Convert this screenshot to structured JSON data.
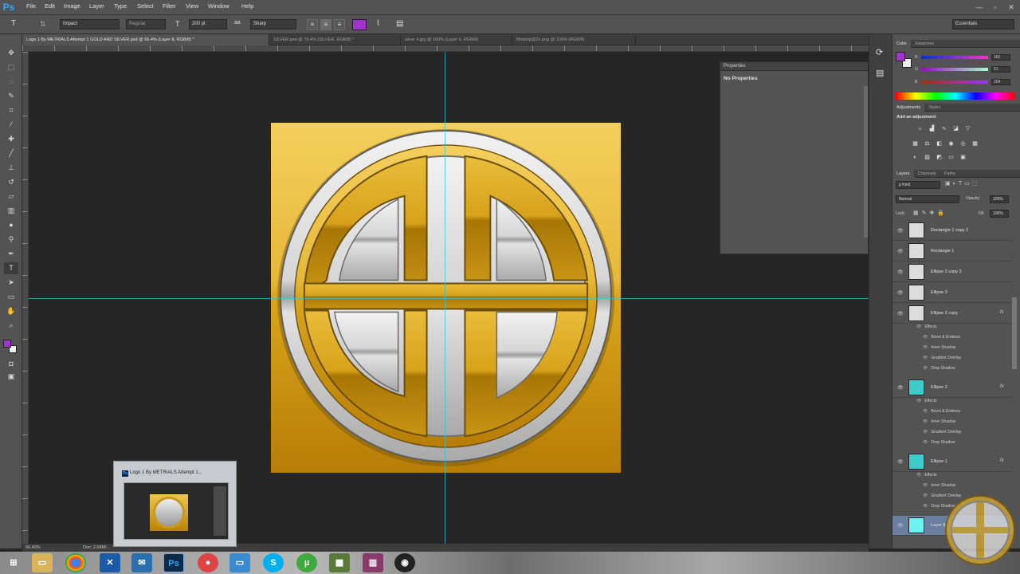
{
  "app": {
    "logo": "Ps",
    "menu": [
      "File",
      "Edit",
      "Image",
      "Layer",
      "Type",
      "Select",
      "Filter",
      "View",
      "Window",
      "Help"
    ],
    "window_controls": [
      "—",
      "▫",
      "✕"
    ],
    "workspace": "Essentials"
  },
  "options_bar": {
    "font_family": "Impact",
    "font_style": "Regular",
    "font_size": "200 pt",
    "antialias": "Sharp"
  },
  "doc_tabs": [
    "Logo 1 By METRIALS Attempt 1 GOLD AND SILVER.psd @ 66.4% (Layer 8, RGB/8) *",
    "SILVER.psd @ 78.4% (SILVER, RGB/8) *",
    "silver 4.jpg @ 100% (Layer 0, RGB/8)",
    "filmstrip@2x.png @ 100% (RGB/8)"
  ],
  "properties_panel": {
    "header": "Properties",
    "message": "No Properties"
  },
  "status": {
    "zoom": "66.49%",
    "doc": "Doc: 2.68M/..."
  },
  "color_panel": {
    "tabs": [
      "Color",
      "Swatches"
    ],
    "rows": [
      {
        "label": "R",
        "value": "162"
      },
      {
        "label": "G",
        "value": "51"
      },
      {
        "label": "B",
        "value": "204"
      }
    ],
    "foreground": "#a233cc"
  },
  "adjustments_panel": {
    "tabs": [
      "Adjustments",
      "Styles"
    ],
    "title": "Add an adjustment"
  },
  "layers_panel": {
    "tabs": [
      "Layers",
      "Channels",
      "Paths"
    ],
    "kind_filter": "ρ Kind",
    "blend_mode": "Normal",
    "opacity_label": "Opacity:",
    "opacity": "100%",
    "lock_label": "Lock:",
    "fill_label": "Fill:",
    "fill": "100%",
    "effects_label": "Effects",
    "layers": [
      {
        "name": "Rectangle 1 copy 2",
        "fx": false,
        "effects": [],
        "thumb": "#dcdcdc"
      },
      {
        "name": "Rectangle 1",
        "fx": false,
        "effects": [],
        "thumb": "#dcdcdc"
      },
      {
        "name": "Ellipse 2 copy 3",
        "fx": false,
        "effects": [],
        "thumb": "#dcdcdc"
      },
      {
        "name": "Ellipse 3",
        "fx": false,
        "effects": [],
        "thumb": "#dcdcdc"
      },
      {
        "name": "Ellipse 2 copy",
        "fx": true,
        "effects": [
          "Bevel & Emboss",
          "Inner Shadow",
          "Gradient Overlay",
          "Drop Shadow"
        ],
        "thumb": "#dcdcdc"
      },
      {
        "name": "Ellipse 2",
        "fx": true,
        "effects": [
          "Bevel & Emboss",
          "Inner Shadow",
          "Gradient Overlay",
          "Drop Shadow"
        ],
        "thumb": "#3ecccc"
      },
      {
        "name": "Ellipse 1",
        "fx": true,
        "effects": [
          "Inner Shadow",
          "Gradient Overlay",
          "Drop Shadow"
        ],
        "thumb": "#3ecccc"
      },
      {
        "name": "Layer 8",
        "fx": false,
        "effects": [],
        "thumb": "#6ff2f2"
      }
    ]
  },
  "thumbnail_popup": {
    "title": "Logo 1 By METRIALS Attempt 1..."
  },
  "taskbar": {
    "apps": [
      "windows-start",
      "file-explorer",
      "chrome",
      "app-x",
      "outlook",
      "photoshop",
      "media",
      "remote",
      "skype",
      "utorrent",
      "minecraft",
      "winrar",
      "obs"
    ]
  }
}
